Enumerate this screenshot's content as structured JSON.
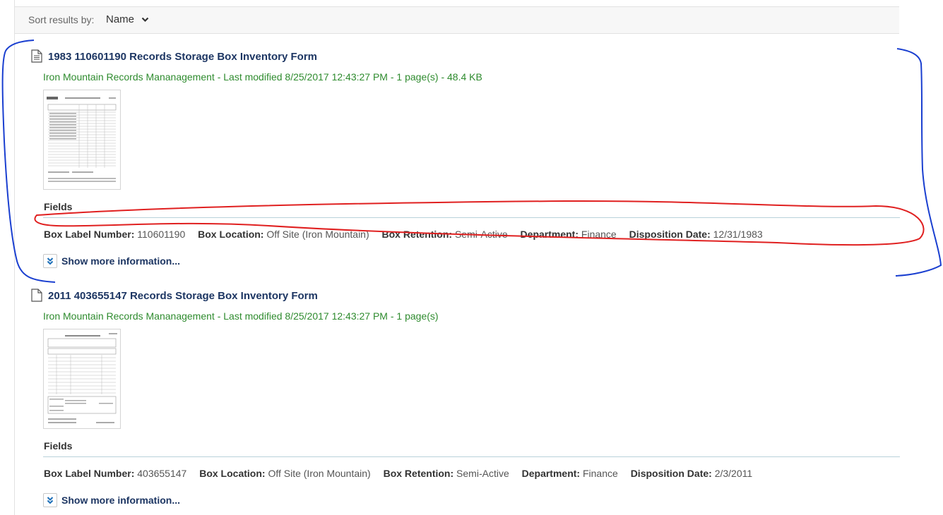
{
  "sort": {
    "label": "Sort results by:",
    "value": "Name"
  },
  "results": [
    {
      "title": "1983 110601190 Records Storage Box Inventory Form",
      "meta": "Iron Mountain Records Mananagement - Last modified 8/25/2017 12:43:27 PM - 1 page(s) - 48.4 KB",
      "fields_heading": "Fields",
      "fields": [
        {
          "label": "Box Label Number:",
          "value": "110601190"
        },
        {
          "label": "Box Location:",
          "value": "Off Site (Iron Mountain)"
        },
        {
          "label": "Box Retention:",
          "value": "Semi-Active"
        },
        {
          "label": "Department:",
          "value": "Finance"
        },
        {
          "label": "Disposition Date:",
          "value": "12/31/1983"
        }
      ],
      "more_label": "Show more information..."
    },
    {
      "title": "2011 403655147 Records Storage Box Inventory Form",
      "meta": "Iron Mountain Records Mananagement - Last modified 8/25/2017 12:43:27 PM - 1 page(s)",
      "fields_heading": "Fields",
      "fields": [
        {
          "label": "Box Label Number:",
          "value": "403655147"
        },
        {
          "label": "Box Location:",
          "value": "Off Site (Iron Mountain)"
        },
        {
          "label": "Box Retention:",
          "value": "Semi-Active"
        },
        {
          "label": "Department:",
          "value": "Finance"
        },
        {
          "label": "Disposition Date:",
          "value": "2/3/2011"
        }
      ],
      "more_label": "Show more information..."
    }
  ],
  "colors": {
    "title": "#1d3663",
    "meta": "#2e8b2e",
    "annotation_red": "#e02020",
    "annotation_blue": "#1a3fd0"
  },
  "icons": {
    "document_with_lines": "document-icon",
    "document_blank": "blank-document-icon",
    "expand": "double-chevron-down-icon",
    "dropdown": "chevron-down-icon"
  }
}
